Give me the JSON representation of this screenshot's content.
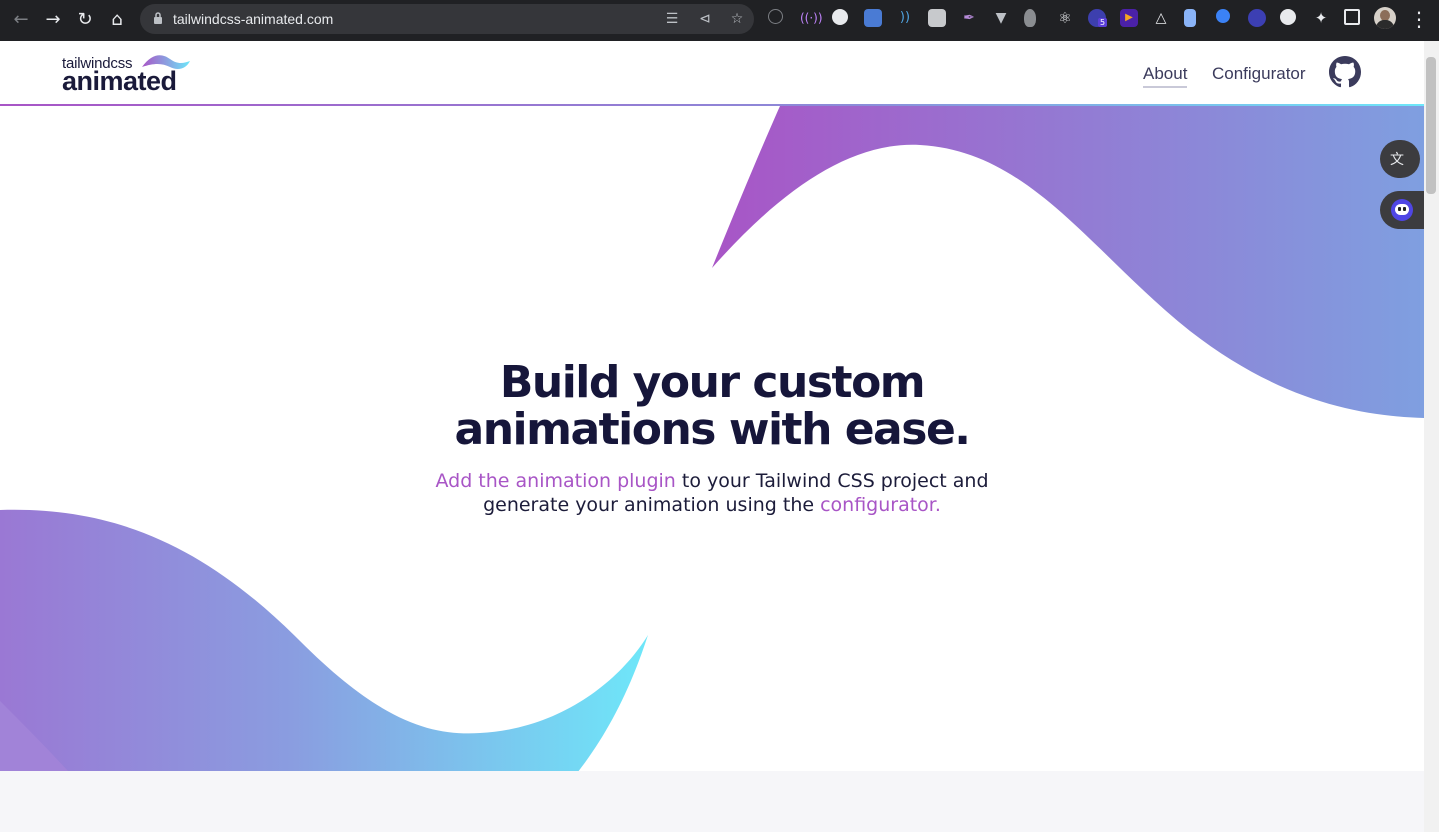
{
  "browser": {
    "url": "tailwindcss-animated.com",
    "extension_badge": "5",
    "accent_colors": {
      "bar": "#202124",
      "omnibox": "#35363a"
    }
  },
  "site": {
    "logo": {
      "top": "tailwindcss",
      "bottom": "animated"
    },
    "nav": {
      "about": "About",
      "configurator": "Configurator"
    }
  },
  "hero": {
    "title_line1": "Build your custom",
    "title_line2": "animations with ease.",
    "sub_link1": "Add the animation plugin",
    "sub_text1": " to your Tailwind CSS project and",
    "sub_text2": "generate your animation using the ",
    "sub_link2": "configurator."
  },
  "colors": {
    "gradient_start": "#a855c6",
    "gradient_mid": "#8b8cd9",
    "gradient_end": "#6ee7f9",
    "heading": "#16163a"
  }
}
